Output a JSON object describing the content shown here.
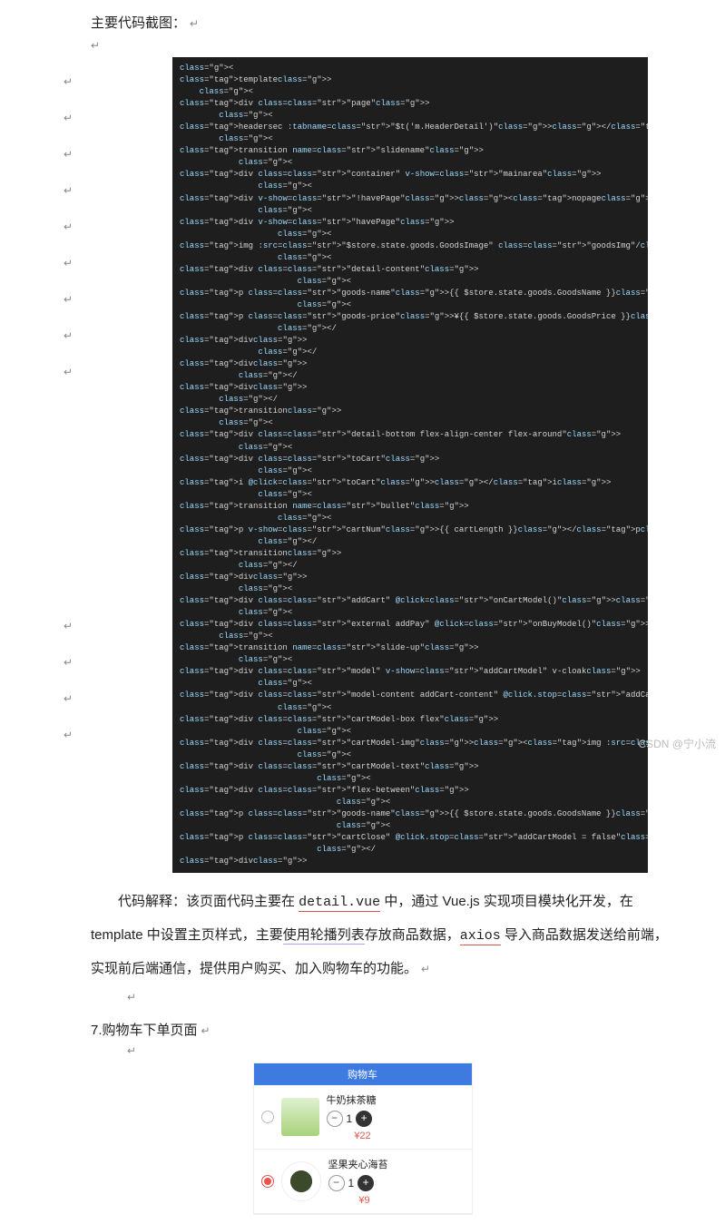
{
  "heading_main": "主要代码截图：",
  "code": {
    "lines": [
      "<template>",
      "    <div class=\"page\">",
      "        <headersec :tabname=\"$t('m.HeaderDetail')\"></headersec>",
      "        <transition name=\"slidename\">",
      "            <div class=\"container\" v-show=\"mainarea\">",
      "                <div v-show=\"!havePage\"><nopage></nopage></div>",
      "                <div v-show=\"havePage\">",
      "                    <img :src=\"$store.state.goods.GoodsImage\" class=\"goodsImg\"/>",
      "                    <div class=\"detail-content\">",
      "                        <p class=\"goods-name\">{{ $store.state.goods.GoodsName }}</p>",
      "                        <p class=\"goods-price\">¥{{ $store.state.goods.GoodsPrice }}</p>",
      "                    </div>",
      "                </div>",
      "            </div>",
      "        </transition>",
      "        <div class=\"detail-bottom flex-align-center flex-around\">",
      "            <div class=\"toCart\">",
      "                <i @click=\"toCart\"></i>",
      "                <transition name=\"bullet\">",
      "                    <p v-show=\"cartNum\">{{ cartLength }}</p>",
      "                </transition>",
      "            </div>",
      "",
      "            <div class=\"addCart\" @click=\"onCartModel()\"><span class=\"tabbar-label\">加入购物车</span></div>",
      "            <div class=\"external addPay\" @click=\"onBuyModel()\"><span class=\"tabbar-label\">立即购买</span></div>",
      "",
      "        <transition name=\"slide-up\">",
      "            <div class=\"model\" v-show=\"addCartModel\" v-cloak>",
      "                <div class=\"model-content addCart-content\" @click.stop=\"addCartModel = true\">",
      "                    <div class=\"cartModel-box flex\">",
      "                        <div class=\"cartModel-img\"><img :src=\"$store.state.goods.GoodsImage\" /></div>",
      "                        <div class=\"cartModel-text\">",
      "                            <div class=\"flex-between\">",
      "                                <p class=\"goods-name\">{{ $store.state.goods.GoodsName }}</p>",
      "                                <p class=\"cartClose\" @click.stop=\"addCartModel = false\"></p>",
      "                            </div>"
    ]
  },
  "explain": {
    "lead": "代码解释：该页面代码主要在 ",
    "u1": "detail.vue",
    "p1": " 中，通过 Vue.js 实现项目模块化开发，在 template 中设置主页样式，主要",
    "u2": "使用轮播列表",
    "p2": "存放商品数据，",
    "u3": "axios",
    "p3": " 导入商品数据发送给前端，实现前后端通信，提供用户购买、加入购物车的功能。"
  },
  "section7": "7.购物车下单页面",
  "cart": {
    "title": "购物车",
    "items": [
      {
        "name": "牛奶抹茶糖",
        "qty": "1",
        "price": "¥22",
        "selected": false
      },
      {
        "name": "坚果夹心海苔",
        "qty": "1",
        "price": "¥9",
        "selected": true
      }
    ]
  },
  "watermark": "CSDN @宁小流"
}
